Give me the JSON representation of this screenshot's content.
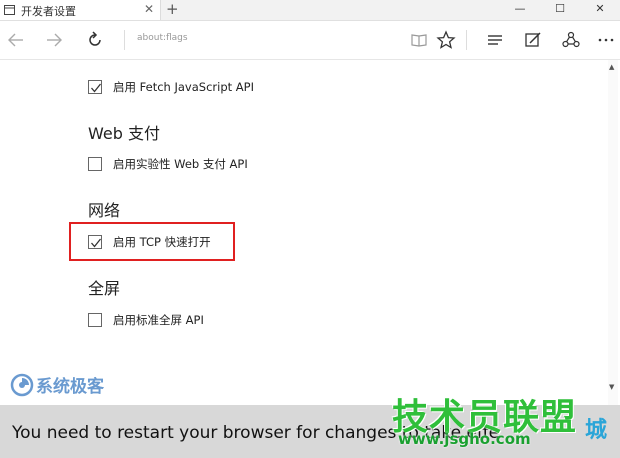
{
  "tab": {
    "title": "开发者设置",
    "close": "✕",
    "new": "+"
  },
  "window": {
    "minimize": "—",
    "maximize": "☐",
    "close": "✕"
  },
  "address": {
    "url": "about:flags"
  },
  "sections": [
    {
      "type": "checkbox",
      "label": "启用 Fetch JavaScript API",
      "checked": true
    },
    {
      "type": "heading",
      "label": "Web 支付"
    },
    {
      "type": "checkbox",
      "label": "启用实验性 Web 支付 API",
      "checked": false
    },
    {
      "type": "heading",
      "label": "网络"
    },
    {
      "type": "checkbox",
      "label": "启用 TCP 快速打开",
      "checked": true
    },
    {
      "type": "heading",
      "label": "全屏"
    },
    {
      "type": "checkbox",
      "label": "启用标准全屏 API",
      "checked": false
    }
  ],
  "notification": {
    "text": "You need to restart your browser for changes to take effe"
  },
  "watermarks": {
    "brand1": "系统极客",
    "brand2": "技术员联盟",
    "brand2_site": "www.jsgho.com",
    "brand2_char": "城"
  },
  "colors": {
    "highlight": "#e02020",
    "notify_bg": "#d8d8d8",
    "watermark_green": "#2fbf3a"
  }
}
